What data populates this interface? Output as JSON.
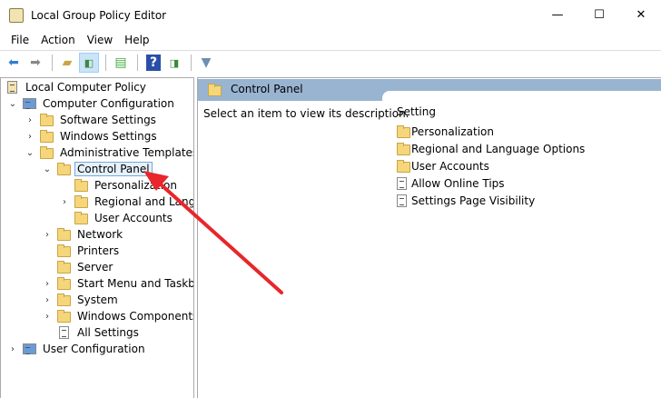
{
  "window": {
    "title": "Local Group Policy Editor",
    "minimize": "—",
    "maximize": "☐",
    "close": "✕"
  },
  "menu": [
    "File",
    "Action",
    "View",
    "Help"
  ],
  "tree": [
    {
      "label": "Local Computer Policy",
      "level": 0,
      "chev": "",
      "icon": "policy"
    },
    {
      "label": "Computer Configuration",
      "level": 1,
      "chev": "⌄",
      "icon": "computer"
    },
    {
      "label": "Software Settings",
      "level": 2,
      "chev": "›",
      "icon": "folder"
    },
    {
      "label": "Windows Settings",
      "level": 2,
      "chev": "›",
      "icon": "folder"
    },
    {
      "label": "Administrative Templates",
      "level": 2,
      "chev": "⌄",
      "icon": "folder"
    },
    {
      "label": "Control Panel",
      "level": 3,
      "chev": "⌄",
      "icon": "folder",
      "selected": true
    },
    {
      "label": "Personalization",
      "level": 4,
      "chev": "",
      "icon": "folder"
    },
    {
      "label": "Regional and Language Options",
      "level": 4,
      "chev": "›",
      "icon": "folder"
    },
    {
      "label": "User Accounts",
      "level": 4,
      "chev": "",
      "icon": "folder"
    },
    {
      "label": "Network",
      "level": 3,
      "chev": "›",
      "icon": "folder"
    },
    {
      "label": "Printers",
      "level": 3,
      "chev": "",
      "icon": "folder"
    },
    {
      "label": "Server",
      "level": 3,
      "chev": "",
      "icon": "folder"
    },
    {
      "label": "Start Menu and Taskbar",
      "level": 3,
      "chev": "›",
      "icon": "folder"
    },
    {
      "label": "System",
      "level": 3,
      "chev": "›",
      "icon": "folder"
    },
    {
      "label": "Windows Components",
      "level": 3,
      "chev": "›",
      "icon": "folder"
    },
    {
      "label": "All Settings",
      "level": 3,
      "chev": "",
      "icon": "doc"
    },
    {
      "label": "User Configuration",
      "level": 1,
      "chev": "›",
      "icon": "computer"
    }
  ],
  "right": {
    "header": "Control Panel",
    "description": "Select an item to view its description.",
    "column": "Setting",
    "items": [
      {
        "label": "Personalization",
        "icon": "folder"
      },
      {
        "label": "Regional and Language Options",
        "icon": "folder"
      },
      {
        "label": "User Accounts",
        "icon": "folder"
      },
      {
        "label": "Allow Online Tips",
        "icon": "doc"
      },
      {
        "label": "Settings Page Visibility",
        "icon": "doc"
      }
    ]
  },
  "colors": {
    "header": "#99b4d1",
    "arrow": "#e8262b"
  }
}
